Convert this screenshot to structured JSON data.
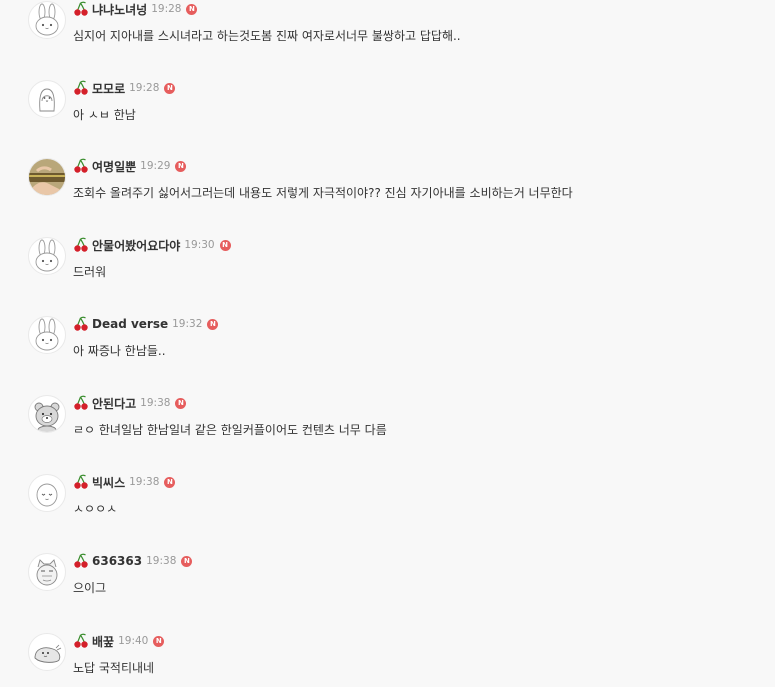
{
  "colors": {
    "background": "#f8f8f8",
    "nickname": "#333333",
    "time": "#999999",
    "badge": "#e65d5d",
    "cherry_red": "#d4202a",
    "cherry_stem": "#3a8d2e"
  },
  "badge_label": "N",
  "comments": [
    {
      "avatar": "rabbit-avatar",
      "nickname": "냐냐노녀넝",
      "time": "19:28",
      "text": "심지어 지아내를 스시녀라고 하는것도봄 진짜 여자로서너무 불쌍하고 답답해.."
    },
    {
      "avatar": "penguin-avatar",
      "nickname": "모모로",
      "time": "19:28",
      "text": "아 ㅅㅂ 한남"
    },
    {
      "avatar": "hand-photo-avatar",
      "nickname": "여명일뿐",
      "time": "19:29",
      "text": "조회수 올려주기 싫어서그러는데 내용도 저렇게 자극적이야?? 진심 자기아내를 소비하는거 너무한다"
    },
    {
      "avatar": "rabbit-avatar",
      "nickname": "안물어봤어요다야",
      "time": "19:30",
      "text": "드러워"
    },
    {
      "avatar": "rabbit-avatar",
      "nickname": "Dead verse",
      "time": "19:32",
      "text": "아 짜증나 한남들.."
    },
    {
      "avatar": "bear-avatar",
      "nickname": "안된다고",
      "time": "19:38",
      "text": "ㄹㅇ 한녀일남 한남일녀 같은 한일커플이어도 컨텐츠 너무 다름"
    },
    {
      "avatar": "bean-avatar",
      "nickname": "빅씨스",
      "time": "19:38",
      "text": "ㅅㅇㅇㅅ"
    },
    {
      "avatar": "cat-avatar",
      "nickname": "636363",
      "time": "19:38",
      "text": "으이그"
    },
    {
      "avatar": "seal-avatar",
      "nickname": "배꿒",
      "time": "19:40",
      "text": "노답 국적티내네"
    }
  ]
}
